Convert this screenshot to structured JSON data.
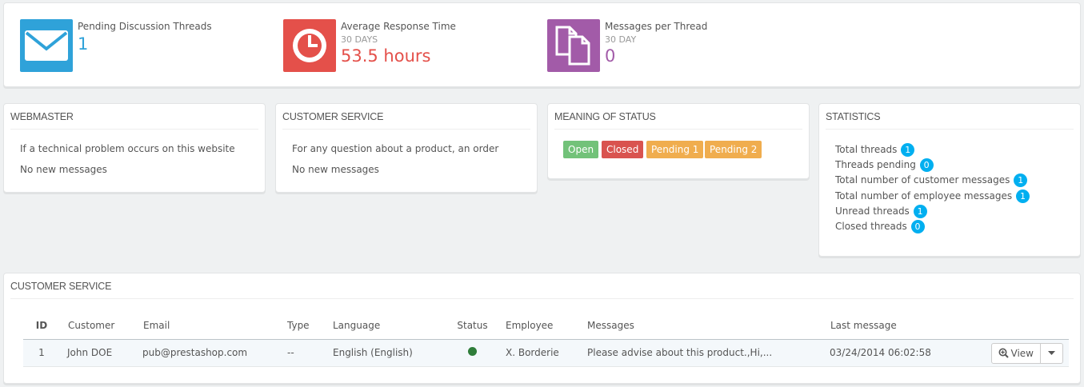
{
  "kpis": {
    "pending": {
      "title": "Pending Discussion Threads",
      "value": "1",
      "color": "#2fa2d9"
    },
    "response": {
      "title": "Average Response Time",
      "subtitle": "30 DAYS",
      "value": "53.5 hours",
      "color": "#e4504a"
    },
    "messages": {
      "title": "Messages per Thread",
      "subtitle": "30 DAY",
      "value": "0",
      "color": "#a25ba8"
    }
  },
  "webmaster": {
    "heading": "WEBMASTER",
    "description": "If a technical problem occurs on this website",
    "status": "No new messages"
  },
  "customer_service_contact": {
    "heading": "CUSTOMER SERVICE",
    "description": "For any question about a product, an order",
    "status": "No new messages"
  },
  "meaning_of_status": {
    "heading": "MEANING OF STATUS",
    "labels": [
      {
        "text": "Open",
        "color": "#72c279"
      },
      {
        "text": "Closed",
        "color": "#e08f95"
      },
      {
        "text": "Pending 1",
        "color": "#fbbb22"
      },
      {
        "text": "Pending 2",
        "color": "#fbbb22"
      }
    ]
  },
  "statistics": {
    "heading": "STATISTICS",
    "rows": [
      {
        "label": "Total threads",
        "value": "1"
      },
      {
        "label": "Threads pending",
        "value": "0"
      },
      {
        "label": "Total number of customer messages",
        "value": "1"
      },
      {
        "label": "Total number of employee messages",
        "value": "1"
      },
      {
        "label": "Unread threads",
        "value": "1"
      },
      {
        "label": "Closed threads",
        "value": "0"
      }
    ]
  },
  "threads": {
    "heading": "CUSTOMER SERVICE",
    "columns": [
      "ID",
      "Customer",
      "Email",
      "Type",
      "Language",
      "Status",
      "Employee",
      "Messages",
      "Last message"
    ],
    "rows": [
      {
        "id": "1",
        "customer": "John DOE",
        "email": "pub@prestashop.com",
        "type": "--",
        "language": "English (English)",
        "status_color": "#2f7d3a",
        "employee": "X. Borderie",
        "messages": "Please advise about this product.,Hi,...",
        "last_message": "03/24/2014 06:02:58",
        "view_label": "View"
      }
    ]
  }
}
